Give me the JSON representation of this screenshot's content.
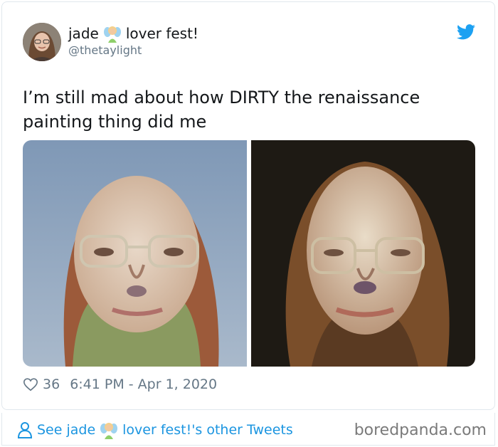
{
  "tweet": {
    "author_name_part1": "jade",
    "author_name_part2": "lover fest!",
    "author_emoji": "fairy-emoji",
    "handle": "@thetaylight",
    "text": "I’m still mad about how DIRTY the renaissance painting thing did me",
    "like_count": "36",
    "timestamp": "6:41 PM - Apr 1, 2020"
  },
  "footer": {
    "see_tweets_part1": "See jade",
    "see_tweets_part2": "lover fest!'s other Tweets"
  },
  "watermark": "boredpanda.com",
  "colors": {
    "link": "#1b95e0",
    "muted": "#657786",
    "text": "#14171a",
    "twitter_blue": "#1da1f2"
  },
  "icons": [
    "twitter-bird-icon",
    "heart-icon",
    "person-icon",
    "fairy-emoji"
  ]
}
